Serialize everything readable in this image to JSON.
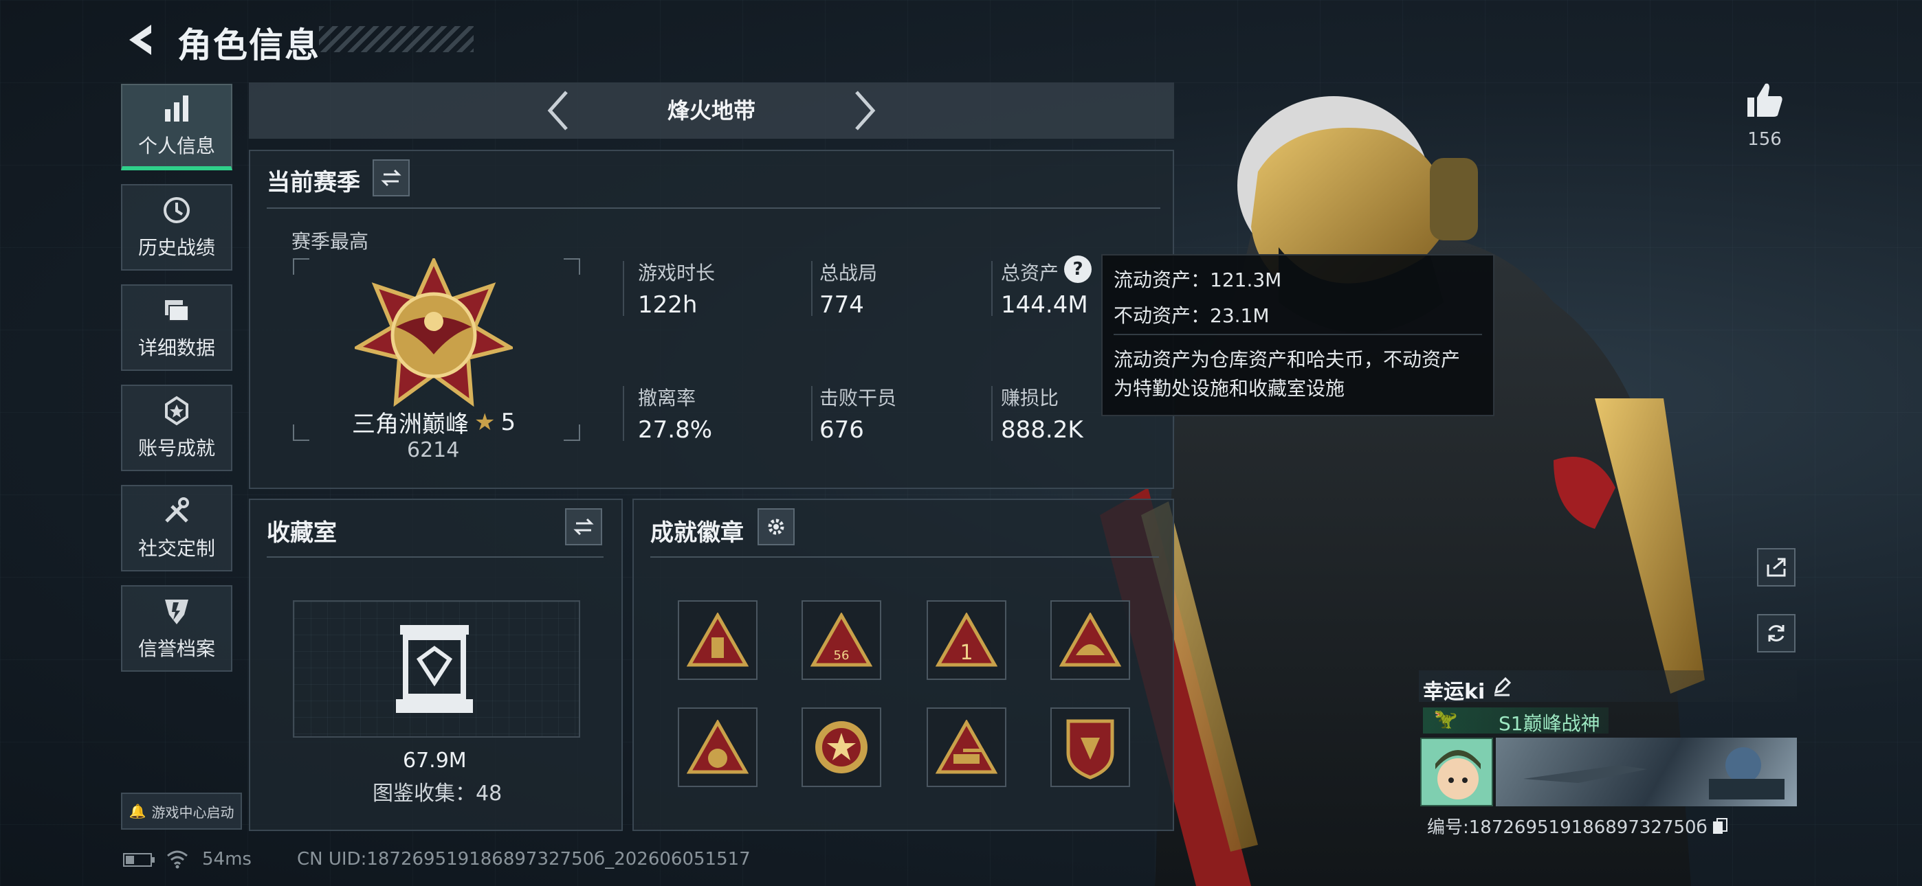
{
  "header": {
    "title": "角色信息"
  },
  "nav": [
    {
      "label": "个人信息",
      "icon": "bar-chart-icon",
      "active": true
    },
    {
      "label": "历史战绩",
      "icon": "history-icon"
    },
    {
      "label": "详细数据",
      "icon": "folder-icon"
    },
    {
      "label": "账号成就",
      "icon": "achievement-icon"
    },
    {
      "label": "社交定制",
      "icon": "tools-icon"
    },
    {
      "label": "信誉档案",
      "icon": "shield-icon"
    }
  ],
  "launcher": {
    "label": "游戏中心启动"
  },
  "mode_tab": {
    "label": "烽火地带"
  },
  "season": {
    "title": "当前赛季",
    "highest_label": "赛季最高",
    "rank_name": "三角洲巅峰",
    "rank_stars": "5",
    "rank_points": "6214",
    "stats": [
      {
        "label": "游戏时长",
        "value": "122h"
      },
      {
        "label": "总战局",
        "value": "774"
      },
      {
        "label": "总资产",
        "value": "144.4M"
      },
      {
        "label": "撤离率",
        "value": "27.8%"
      },
      {
        "label": "击败干员",
        "value": "676"
      },
      {
        "label": "赚损比",
        "value": "888.2K"
      }
    ]
  },
  "tooltip": {
    "liquid": "流动资产：121.3M",
    "fixed": "不动资产：23.1M",
    "desc_line1": "流动资产为仓库资产和哈夫币，不动资产",
    "desc_line2": "为特勤处设施和收藏室设施"
  },
  "collection": {
    "title": "收藏室",
    "value": "67.9M",
    "catalog": "图鉴收集：48"
  },
  "badges": {
    "title": "成就徽章",
    "items": [
      {
        "icon": "badge-bottle-icon",
        "color": "#b8892c"
      },
      {
        "icon": "badge-56-icon",
        "color": "#b8892c"
      },
      {
        "icon": "badge-one-icon",
        "color": "#b8892c"
      },
      {
        "icon": "badge-helmet-icon",
        "color": "#b8892c"
      },
      {
        "icon": "badge-bag-icon",
        "color": "#b8892c"
      },
      {
        "icon": "badge-star-medal-icon",
        "color": "#b8892c"
      },
      {
        "icon": "badge-tank-icon",
        "color": "#b8892c"
      },
      {
        "icon": "badge-shield-icon",
        "color": "#b8892c"
      }
    ]
  },
  "likes": {
    "count": "156"
  },
  "player": {
    "name": "幸运ki",
    "title": "S1巅峰战神",
    "id_line": "编号:18726951918689732750б"
  },
  "status_bar": {
    "ping": "54ms",
    "uid": "CN UID:18726951918689732750б_202606051517"
  },
  "colors": {
    "accent": "#2fd08a",
    "gold": "#c9a14a",
    "panel": "#1e2830"
  }
}
